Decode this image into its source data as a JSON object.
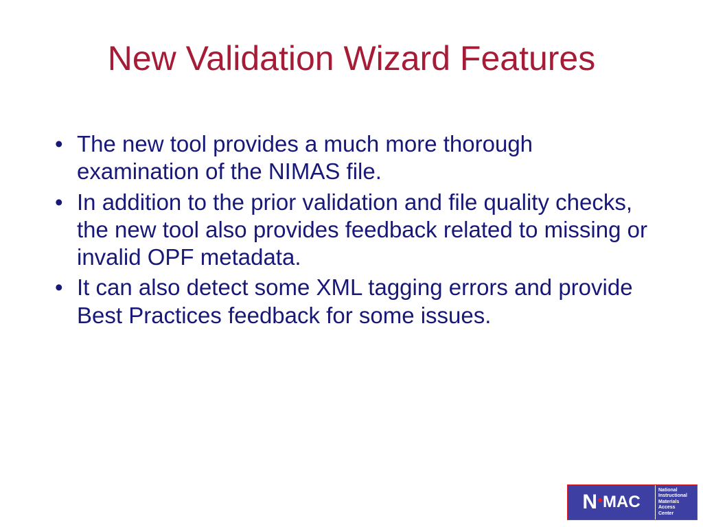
{
  "title": "New Validation Wizard Features",
  "bullets": [
    "The new tool provides a much more thorough examination of the NIMAS file.",
    "In addition to the prior validation and file quality checks, the new tool also provides feedback related to missing or invalid OPF metadata.",
    "It can also detect some XML tagging errors and provide Best Practices feedback for some issues."
  ],
  "logo": {
    "name_part1": "N",
    "name_part2": "MAC",
    "full1": "National",
    "full2": "Instructional",
    "full3": "Materials",
    "full4": "Access",
    "full5": "Center"
  }
}
